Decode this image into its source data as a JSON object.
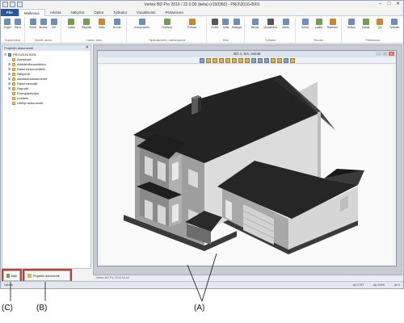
{
  "window": {
    "title": "Vertex BD Pro 2016 / 22.0.00 (beta) (r150360) - PRO\\2016-0001",
    "controls": [
      "–",
      "□",
      "✕"
    ]
  },
  "ribbon": {
    "tabs": [
      "File",
      "Mallinnus",
      "Arkista",
      "Näkymä",
      "Optiot",
      "Työkalut",
      "Visualisointi",
      "Piirtäminen"
    ],
    "active_tab": "Mallinnus",
    "groups": [
      {
        "label": "Kopioi/siirrä",
        "tools": [
          {
            "label": "Kopioi",
            "icon": "copy-icon"
          },
          {
            "label": "Siirrä",
            "icon": "move-icon"
          }
        ]
      },
      {
        "label": "Seinät, aukot",
        "tools": [
          {
            "label": "Seinä",
            "icon": "wall-icon"
          },
          {
            "label": "Ikkuna",
            "icon": "window-icon"
          },
          {
            "label": "Ovi",
            "icon": "door-icon"
          }
        ]
      },
      {
        "label": "Laatta, katto",
        "tools": [
          {
            "label": "Laatta",
            "icon": "slab-icon"
          },
          {
            "label": "Räystäs",
            "icon": "eave-icon"
          },
          {
            "label": "Katto",
            "icon": "roof-icon"
          },
          {
            "label": "Huone",
            "icon": "room-icon"
          }
        ]
      },
      {
        "label": "Tilpärakenteet, rakennusosa",
        "tools": [
          {
            "label": "Komponentti",
            "icon": "component-icon"
          },
          {
            "label": "Ohutlevy",
            "icon": "sheet-icon"
          },
          {
            "label": "Portaat",
            "icon": "stairs-icon"
          }
        ]
      },
      {
        "label": "Ulko",
        "tools": [
          {
            "label": "Profiili",
            "icon": "profile-icon"
          },
          {
            "label": "Jalka",
            "icon": "foot-icon"
          },
          {
            "label": "Etäisyys",
            "icon": "distance-icon"
          }
        ]
      },
      {
        "label": "Työkalut",
        "tools": [
          {
            "label": "Mitoita",
            "icon": "dimension-icon"
          },
          {
            "label": "Moduliviiva",
            "icon": "grid-icon"
          },
          {
            "label": "Aseta",
            "icon": "place-icon"
          }
        ]
      },
      {
        "label": "Ruudut",
        "tools": [
          {
            "label": "Seinä",
            "icon": "wall-icon"
          },
          {
            "label": "Laatta",
            "icon": "slab-icon"
          },
          {
            "label": "Rakenne",
            "icon": "structure-icon"
          }
        ]
      },
      {
        "label": "Piirtäminen",
        "tools": [
          {
            "label": "Aktivoi",
            "icon": "activate-icon"
          },
          {
            "label": "Detalji",
            "icon": "detail-icon"
          },
          {
            "label": "Q4",
            "icon": "q4-icon"
          },
          {
            "label": "Työkalut",
            "icon": "tools-icon"
          }
        ]
      }
    ]
  },
  "tree_panel": {
    "title": "Projektin dokumentit",
    "close": "✕",
    "nodes": [
      {
        "label": "PRO\\2016-0001",
        "exp": "⊟",
        "icon": "project-icon",
        "level": 0
      },
      {
        "label": "Asetukset",
        "exp": "",
        "icon": "folder-icon",
        "level": 1
      },
      {
        "label": "Arkkitehtisuunnittelu",
        "exp": "⊞",
        "icon": "folder-icon",
        "level": 1
      },
      {
        "label": "Rakennesuunnittelu",
        "exp": "⊞",
        "icon": "folder-icon",
        "level": 1
      },
      {
        "label": "Näkymät",
        "exp": "⊞",
        "icon": "folder-icon",
        "level": 1
      },
      {
        "label": "Aikataulutdokumentit",
        "exp": "⊞",
        "icon": "folder-icon",
        "level": 1
      },
      {
        "label": "Rakennemallit",
        "exp": "⊞",
        "icon": "folder-icon",
        "level": 1
      },
      {
        "label": "Raportit",
        "exp": "⊞",
        "icon": "folder-icon",
        "level": 1
      },
      {
        "label": "Energiaselvitys",
        "exp": "",
        "icon": "folder-icon",
        "level": 1
      },
      {
        "label": "Luettelo",
        "exp": "",
        "icon": "folder-icon",
        "level": 1
      },
      {
        "label": "Liitetyt dokumentit",
        "exp": "",
        "icon": "folder-icon",
        "level": 1
      }
    ]
  },
  "viewport": {
    "title": "3D\\ 1. krs, seinät",
    "controls": [
      "–",
      "□",
      "✕"
    ],
    "colors": {
      "roof": "#232323",
      "wall_light": "#dcdcdc",
      "wall_shade": "#9e9e9e",
      "base": "#3a3a3a"
    }
  },
  "app_status_text": "Vertex BD Pro 2016 64-bit",
  "bottom_tabs": {
    "malli": "Malli",
    "projektin_dokumentit": "Projektin dokumentit"
  },
  "statusbar": {
    "left": "Valmis",
    "dx": "dx 1757",
    "dy": "dy 3399",
    "dz": "dz 0"
  },
  "callouts": {
    "a": "(A)",
    "b": "(B)",
    "c": "(C)"
  },
  "callout_color": "#c63a2a"
}
